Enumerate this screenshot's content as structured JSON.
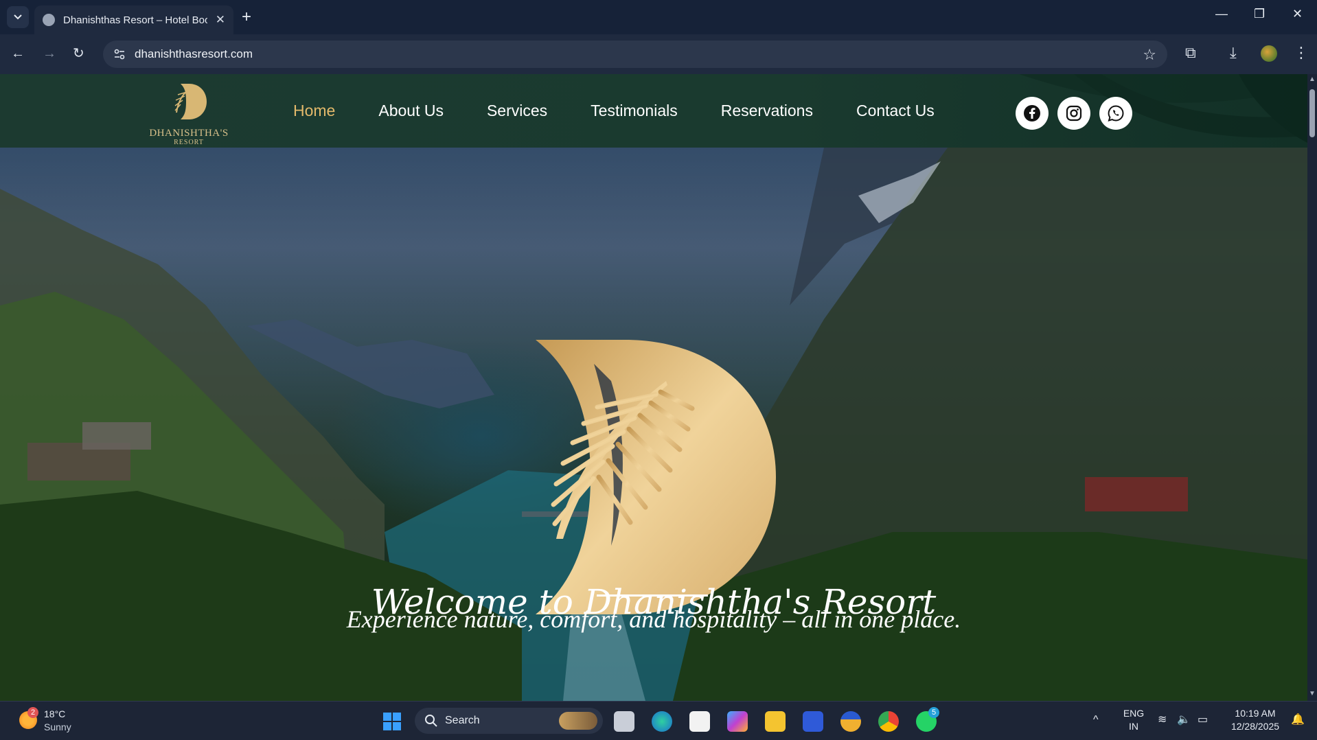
{
  "browser": {
    "tab_title": "Dhanishthas Resort – Hotel Boo",
    "url": "dhanishthasresort.com"
  },
  "site": {
    "logo": {
      "name": "DHANISHTHA'S",
      "sub": "RESORT"
    },
    "menu": [
      {
        "label": "Home",
        "active": true
      },
      {
        "label": "About Us"
      },
      {
        "label": "Services"
      },
      {
        "label": "Testimonials"
      },
      {
        "label": "Reservations"
      },
      {
        "label": "Contact Us"
      }
    ],
    "social": [
      "facebook-icon",
      "instagram-icon",
      "whatsapp-icon"
    ],
    "hero": {
      "welcome": "Welcome to Dhanishtha's Resort",
      "tagline": "Experience nature, comfort, and hospitality – all in one place."
    },
    "colors": {
      "accent": "#e3b96b",
      "header_bg": "#1c3a30",
      "gold": "#d8b774"
    }
  },
  "taskbar": {
    "weather": {
      "temp": "18°C",
      "condition": "Sunny",
      "badge": "2"
    },
    "search_label": "Search",
    "whatsapp_badge": "5",
    "lang": {
      "line1": "ENG",
      "line2": "IN"
    },
    "clock": {
      "time": "10:19 AM",
      "date": "12/28/2025"
    }
  }
}
